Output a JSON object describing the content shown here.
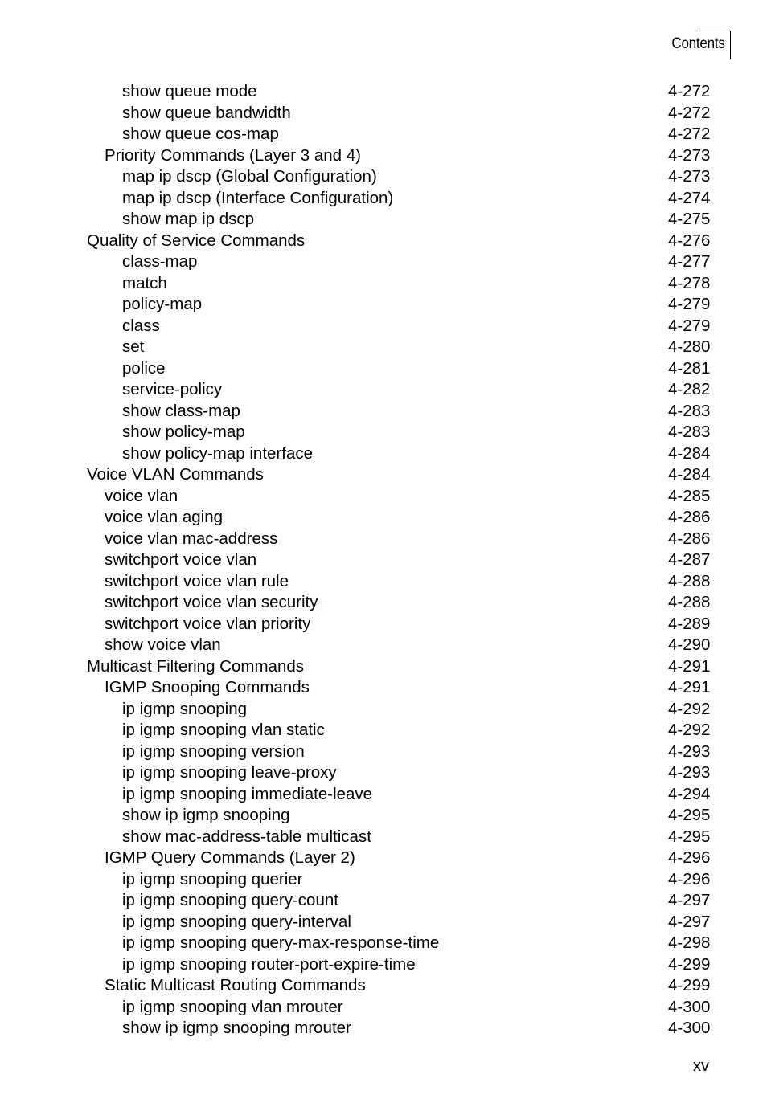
{
  "header": {
    "title": "Contents"
  },
  "toc": {
    "entries": [
      {
        "label": "show queue mode",
        "page": "4-272",
        "level": 3
      },
      {
        "label": "show queue bandwidth",
        "page": "4-272",
        "level": 3
      },
      {
        "label": "show queue cos-map",
        "page": "4-272",
        "level": 3
      },
      {
        "label": "Priority Commands (Layer 3 and 4)",
        "page": "4-273",
        "level": 2
      },
      {
        "label": "map ip dscp (Global Configuration)",
        "page": "4-273",
        "level": 3
      },
      {
        "label": "map ip dscp (Interface Configuration)",
        "page": "4-274",
        "level": 3
      },
      {
        "label": "show map ip dscp",
        "page": "4-275",
        "level": 3
      },
      {
        "label": "Quality of Service Commands",
        "page": "4-276",
        "level": 1
      },
      {
        "label": "class-map",
        "page": "4-277",
        "level": 3
      },
      {
        "label": "match",
        "page": "4-278",
        "level": 3
      },
      {
        "label": "policy-map",
        "page": "4-279",
        "level": 3
      },
      {
        "label": "class",
        "page": "4-279",
        "level": 3
      },
      {
        "label": "set",
        "page": "4-280",
        "level": 3
      },
      {
        "label": "police",
        "page": "4-281",
        "level": 3
      },
      {
        "label": "service-policy",
        "page": "4-282",
        "level": 3
      },
      {
        "label": "show class-map",
        "page": "4-283",
        "level": 3
      },
      {
        "label": "show policy-map",
        "page": "4-283",
        "level": 3
      },
      {
        "label": "show policy-map interface",
        "page": "4-284",
        "level": 3
      },
      {
        "label": "Voice VLAN Commands",
        "page": "4-284",
        "level": 1
      },
      {
        "label": "voice vlan",
        "page": "4-285",
        "level": 2
      },
      {
        "label": "voice vlan aging",
        "page": "4-286",
        "level": 2
      },
      {
        "label": "voice vlan mac-address",
        "page": "4-286",
        "level": 2
      },
      {
        "label": "switchport voice vlan",
        "page": "4-287",
        "level": 2
      },
      {
        "label": "switchport voice vlan rule",
        "page": "4-288",
        "level": 2
      },
      {
        "label": "switchport voice vlan security",
        "page": "4-288",
        "level": 2
      },
      {
        "label": "switchport voice vlan priority",
        "page": "4-289",
        "level": 2
      },
      {
        "label": "show voice vlan",
        "page": "4-290",
        "level": 2
      },
      {
        "label": "Multicast Filtering Commands",
        "page": "4-291",
        "level": 1
      },
      {
        "label": "IGMP Snooping Commands",
        "page": "4-291",
        "level": 2
      },
      {
        "label": "ip igmp snooping",
        "page": "4-292",
        "level": 3
      },
      {
        "label": "ip igmp snooping vlan static",
        "page": "4-292",
        "level": 3
      },
      {
        "label": "ip igmp snooping version",
        "page": "4-293",
        "level": 3
      },
      {
        "label": "ip igmp snooping leave-proxy",
        "page": "4-293",
        "level": 3
      },
      {
        "label": "ip igmp snooping immediate-leave",
        "page": "4-294",
        "level": 3
      },
      {
        "label": "show ip igmp snooping",
        "page": "4-295",
        "level": 3
      },
      {
        "label": "show mac-address-table multicast",
        "page": "4-295",
        "level": 3
      },
      {
        "label": "IGMP Query Commands (Layer 2)",
        "page": "4-296",
        "level": 2
      },
      {
        "label": "ip igmp snooping querier",
        "page": "4-296",
        "level": 3
      },
      {
        "label": "ip igmp snooping query-count",
        "page": "4-297",
        "level": 3
      },
      {
        "label": "ip igmp snooping query-interval",
        "page": "4-297",
        "level": 3
      },
      {
        "label": "ip igmp snooping query-max-response-time",
        "page": "4-298",
        "level": 3
      },
      {
        "label": "ip igmp snooping router-port-expire-time",
        "page": "4-299",
        "level": 3
      },
      {
        "label": "Static Multicast Routing Commands",
        "page": "4-299",
        "level": 2
      },
      {
        "label": "ip igmp snooping vlan mrouter",
        "page": "4-300",
        "level": 3
      },
      {
        "label": "show ip igmp snooping mrouter",
        "page": "4-300",
        "level": 3
      }
    ]
  },
  "footer": {
    "page_number": "xv"
  }
}
